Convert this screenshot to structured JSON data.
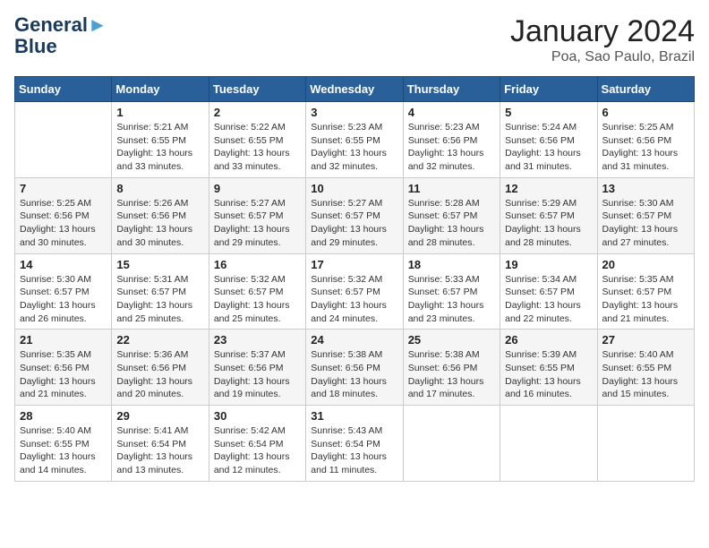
{
  "header": {
    "logo_line1": "General",
    "logo_line2": "Blue",
    "month_title": "January 2024",
    "location": "Poa, Sao Paulo, Brazil"
  },
  "days_of_week": [
    "Sunday",
    "Monday",
    "Tuesday",
    "Wednesday",
    "Thursday",
    "Friday",
    "Saturday"
  ],
  "weeks": [
    [
      {
        "num": "",
        "info": ""
      },
      {
        "num": "1",
        "info": "Sunrise: 5:21 AM\nSunset: 6:55 PM\nDaylight: 13 hours\nand 33 minutes."
      },
      {
        "num": "2",
        "info": "Sunrise: 5:22 AM\nSunset: 6:55 PM\nDaylight: 13 hours\nand 33 minutes."
      },
      {
        "num": "3",
        "info": "Sunrise: 5:23 AM\nSunset: 6:55 PM\nDaylight: 13 hours\nand 32 minutes."
      },
      {
        "num": "4",
        "info": "Sunrise: 5:23 AM\nSunset: 6:56 PM\nDaylight: 13 hours\nand 32 minutes."
      },
      {
        "num": "5",
        "info": "Sunrise: 5:24 AM\nSunset: 6:56 PM\nDaylight: 13 hours\nand 31 minutes."
      },
      {
        "num": "6",
        "info": "Sunrise: 5:25 AM\nSunset: 6:56 PM\nDaylight: 13 hours\nand 31 minutes."
      }
    ],
    [
      {
        "num": "7",
        "info": "Sunrise: 5:25 AM\nSunset: 6:56 PM\nDaylight: 13 hours\nand 30 minutes."
      },
      {
        "num": "8",
        "info": "Sunrise: 5:26 AM\nSunset: 6:56 PM\nDaylight: 13 hours\nand 30 minutes."
      },
      {
        "num": "9",
        "info": "Sunrise: 5:27 AM\nSunset: 6:57 PM\nDaylight: 13 hours\nand 29 minutes."
      },
      {
        "num": "10",
        "info": "Sunrise: 5:27 AM\nSunset: 6:57 PM\nDaylight: 13 hours\nand 29 minutes."
      },
      {
        "num": "11",
        "info": "Sunrise: 5:28 AM\nSunset: 6:57 PM\nDaylight: 13 hours\nand 28 minutes."
      },
      {
        "num": "12",
        "info": "Sunrise: 5:29 AM\nSunset: 6:57 PM\nDaylight: 13 hours\nand 28 minutes."
      },
      {
        "num": "13",
        "info": "Sunrise: 5:30 AM\nSunset: 6:57 PM\nDaylight: 13 hours\nand 27 minutes."
      }
    ],
    [
      {
        "num": "14",
        "info": "Sunrise: 5:30 AM\nSunset: 6:57 PM\nDaylight: 13 hours\nand 26 minutes."
      },
      {
        "num": "15",
        "info": "Sunrise: 5:31 AM\nSunset: 6:57 PM\nDaylight: 13 hours\nand 25 minutes."
      },
      {
        "num": "16",
        "info": "Sunrise: 5:32 AM\nSunset: 6:57 PM\nDaylight: 13 hours\nand 25 minutes."
      },
      {
        "num": "17",
        "info": "Sunrise: 5:32 AM\nSunset: 6:57 PM\nDaylight: 13 hours\nand 24 minutes."
      },
      {
        "num": "18",
        "info": "Sunrise: 5:33 AM\nSunset: 6:57 PM\nDaylight: 13 hours\nand 23 minutes."
      },
      {
        "num": "19",
        "info": "Sunrise: 5:34 AM\nSunset: 6:57 PM\nDaylight: 13 hours\nand 22 minutes."
      },
      {
        "num": "20",
        "info": "Sunrise: 5:35 AM\nSunset: 6:57 PM\nDaylight: 13 hours\nand 21 minutes."
      }
    ],
    [
      {
        "num": "21",
        "info": "Sunrise: 5:35 AM\nSunset: 6:56 PM\nDaylight: 13 hours\nand 21 minutes."
      },
      {
        "num": "22",
        "info": "Sunrise: 5:36 AM\nSunset: 6:56 PM\nDaylight: 13 hours\nand 20 minutes."
      },
      {
        "num": "23",
        "info": "Sunrise: 5:37 AM\nSunset: 6:56 PM\nDaylight: 13 hours\nand 19 minutes."
      },
      {
        "num": "24",
        "info": "Sunrise: 5:38 AM\nSunset: 6:56 PM\nDaylight: 13 hours\nand 18 minutes."
      },
      {
        "num": "25",
        "info": "Sunrise: 5:38 AM\nSunset: 6:56 PM\nDaylight: 13 hours\nand 17 minutes."
      },
      {
        "num": "26",
        "info": "Sunrise: 5:39 AM\nSunset: 6:55 PM\nDaylight: 13 hours\nand 16 minutes."
      },
      {
        "num": "27",
        "info": "Sunrise: 5:40 AM\nSunset: 6:55 PM\nDaylight: 13 hours\nand 15 minutes."
      }
    ],
    [
      {
        "num": "28",
        "info": "Sunrise: 5:40 AM\nSunset: 6:55 PM\nDaylight: 13 hours\nand 14 minutes."
      },
      {
        "num": "29",
        "info": "Sunrise: 5:41 AM\nSunset: 6:54 PM\nDaylight: 13 hours\nand 13 minutes."
      },
      {
        "num": "30",
        "info": "Sunrise: 5:42 AM\nSunset: 6:54 PM\nDaylight: 13 hours\nand 12 minutes."
      },
      {
        "num": "31",
        "info": "Sunrise: 5:43 AM\nSunset: 6:54 PM\nDaylight: 13 hours\nand 11 minutes."
      },
      {
        "num": "",
        "info": ""
      },
      {
        "num": "",
        "info": ""
      },
      {
        "num": "",
        "info": ""
      }
    ]
  ]
}
